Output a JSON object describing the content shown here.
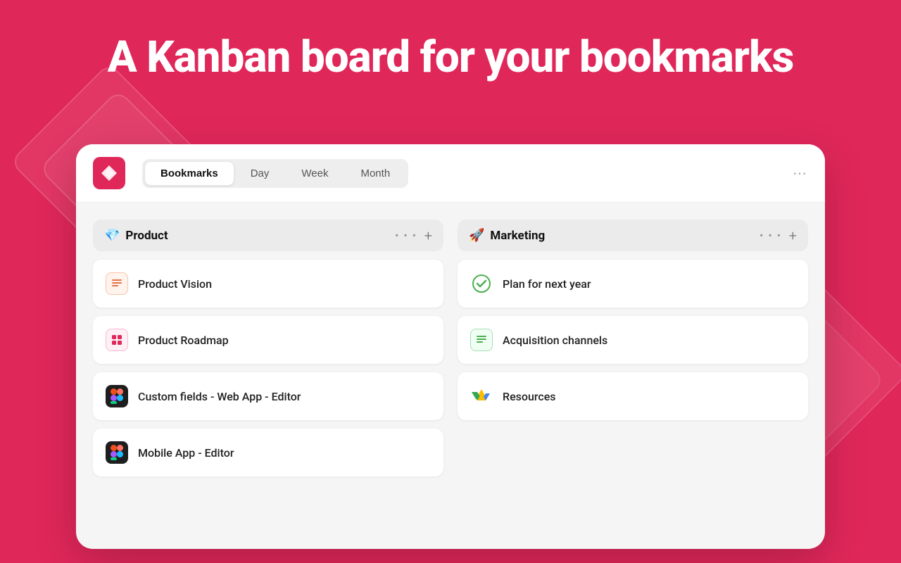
{
  "heading": "A Kanban board for your bookmarks",
  "nav": {
    "tabs": [
      {
        "label": "Bookmarks",
        "active": true
      },
      {
        "label": "Day",
        "active": false
      },
      {
        "label": "Week",
        "active": false
      },
      {
        "label": "Month",
        "active": false
      }
    ],
    "more_icon": "⋯"
  },
  "columns": [
    {
      "id": "product",
      "emoji": "💎",
      "title": "Product",
      "cards": [
        {
          "id": "product-vision",
          "title": "Product Vision",
          "icon_type": "notion-doc"
        },
        {
          "id": "product-roadmap",
          "title": "Product Roadmap",
          "icon_type": "grid"
        },
        {
          "id": "custom-fields",
          "title": "Custom fields - Web App - Editor",
          "icon_type": "figma"
        },
        {
          "id": "mobile-editor",
          "title": "Mobile App - Editor",
          "icon_type": "figma"
        }
      ]
    },
    {
      "id": "marketing",
      "emoji": "🚀",
      "title": "Marketing",
      "cards": [
        {
          "id": "plan-next-year",
          "title": "Plan for next year",
          "icon_type": "check"
        },
        {
          "id": "acquisition",
          "title": "Acquisition channels",
          "icon_type": "doc"
        },
        {
          "id": "resources",
          "title": "Resources",
          "icon_type": "gdrive"
        }
      ]
    }
  ],
  "colors": {
    "brand": "#e0275a",
    "bg": "#e0275a",
    "card_bg": "white",
    "board_bg": "#f5f5f5"
  }
}
